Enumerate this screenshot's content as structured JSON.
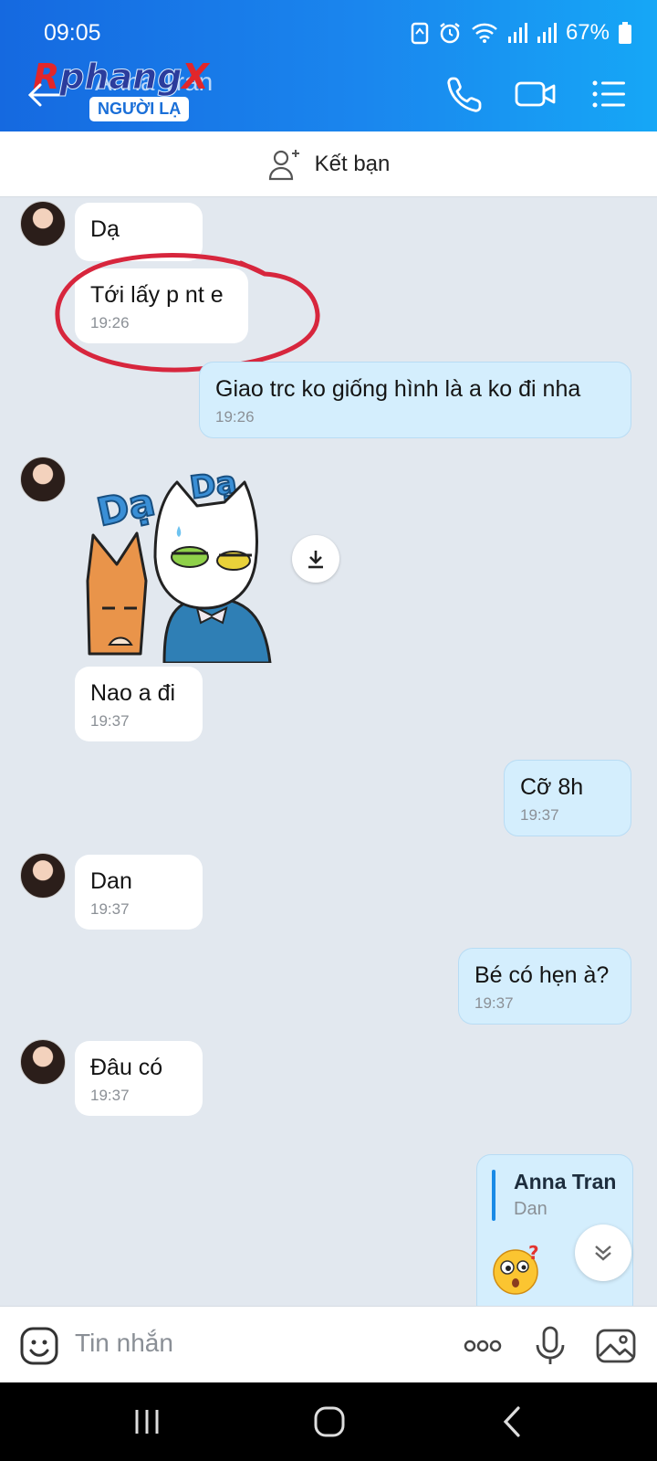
{
  "status_bar": {
    "time": "09:05",
    "battery": "67%"
  },
  "header": {
    "contact_name": "Anna Tran",
    "stranger_badge": "NGƯỜI LẠ",
    "watermark": {
      "r": "R",
      "main": "phang",
      "x": "X"
    }
  },
  "add_friend": {
    "label": "Kết bạn"
  },
  "messages": [
    {
      "side": "in",
      "text": "Dạ",
      "time": ""
    },
    {
      "side": "in",
      "text": "Tới lấy p nt e",
      "time": "19:26"
    },
    {
      "side": "out",
      "text": "Giao trc ko giống hình là a ko đi nha",
      "time": "19:26"
    },
    {
      "side": "in",
      "sticker": "cats-da-da-sticker",
      "sticker_text": [
        "Dạ",
        "Dạ"
      ]
    },
    {
      "side": "in",
      "text": "Nao a đi",
      "time": "19:37"
    },
    {
      "side": "out",
      "text": "Cỡ 8h",
      "time": "19:37"
    },
    {
      "side": "in",
      "text": "Dan",
      "time": "19:37"
    },
    {
      "side": "out",
      "text": "Bé có hẹn à?",
      "time": "19:37"
    },
    {
      "side": "in",
      "text": "Đâu có",
      "time": "19:37"
    }
  ],
  "reply_message": {
    "quoted_name": "Anna Tran",
    "quoted_text": "Dan",
    "emoji": "confused-emoji"
  },
  "input": {
    "placeholder": "Tin nhắn"
  },
  "colors": {
    "header_start": "#1569e0",
    "header_end": "#16a7f6",
    "outgoing_bubble": "#d4eefd",
    "chat_bg": "#e2e8ef",
    "annotation_circle": "#d7263d"
  }
}
